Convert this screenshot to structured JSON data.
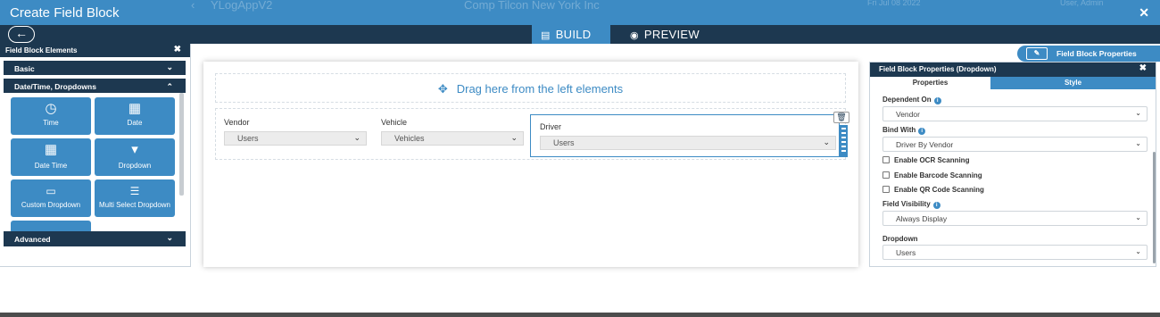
{
  "background_app": {
    "app_name": "YLogAppV2",
    "company": "Comp Tilcon New York Inc",
    "date": "Fri Jul 08 2022",
    "user": "User, Admin"
  },
  "modal": {
    "title": "Create Field Block",
    "close_icon": "close-icon"
  },
  "toolbar": {
    "back_icon": "arrow-left-icon",
    "tabs": [
      {
        "label": "BUILD",
        "icon": "build-icon",
        "active": true
      },
      {
        "label": "PREVIEW",
        "icon": "eye-icon",
        "active": false
      }
    ]
  },
  "left_panel": {
    "title": "Field Block Elements",
    "sections": [
      {
        "label": "Basic",
        "expanded": false
      },
      {
        "label": "Date/Time, Dropdowns",
        "expanded": true
      },
      {
        "label": "Advanced",
        "expanded": false
      }
    ],
    "tiles": [
      {
        "label": "Time",
        "icon": "clock-icon"
      },
      {
        "label": "Date",
        "icon": "calendar-icon"
      },
      {
        "label": "Date Time",
        "icon": "calendar-clock-icon"
      },
      {
        "label": "Dropdown",
        "icon": "caret-down-icon"
      },
      {
        "label": "Custom Dropdown",
        "icon": "custom-dropdown-icon"
      },
      {
        "label": "Multi Select Dropdown",
        "icon": "multi-select-icon"
      }
    ]
  },
  "canvas": {
    "dropzone_text": "Drag here from the left elements",
    "fields": [
      {
        "label": "Vendor",
        "value": "Users"
      },
      {
        "label": "Vehicle",
        "value": "Vehicles"
      },
      {
        "label": "Driver",
        "value": "Users"
      }
    ]
  },
  "field_block_properties_button": "Field Block Properties",
  "right_panel": {
    "title": "Field Block Properties (Dropdown)",
    "tabs": [
      "Properties",
      "Style"
    ],
    "dependent_on": {
      "label": "Dependent On",
      "value": "Vendor"
    },
    "bind_with": {
      "label": "Bind With",
      "value": "Driver By Vendor"
    },
    "checkboxes": [
      {
        "label": "Enable OCR Scanning",
        "checked": false
      },
      {
        "label": "Enable Barcode Scanning",
        "checked": false
      },
      {
        "label": "Enable QR Code Scanning",
        "checked": false
      }
    ],
    "field_visibility": {
      "label": "Field Visibility",
      "value": "Always Display"
    },
    "dropdown": {
      "label": "Dropdown",
      "value": "Users"
    }
  },
  "colors": {
    "primary": "#3d8bc4",
    "dark_navy": "#1d3850"
  }
}
